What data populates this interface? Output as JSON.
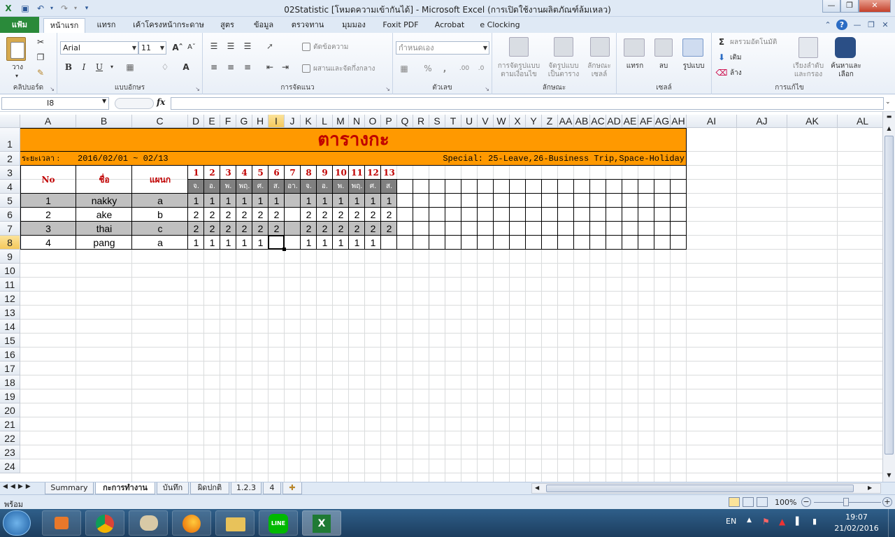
{
  "window": {
    "title": "02Statistic  [โหมดความเข้ากันได้]  - Microsoft Excel (การเปิดใช้งานผลิตภัณฑ์ล้มเหลว)"
  },
  "ribbon_tabs": [
    "แฟ้ม",
    "หน้าแรก",
    "แทรก",
    "เค้าโครงหน้ากระดาษ",
    "สูตร",
    "ข้อมูล",
    "ตรวจทาน",
    "มุมมอง",
    "Foxit PDF",
    "Acrobat",
    "e Clocking"
  ],
  "ribbon": {
    "clipboard": {
      "paste": "วาง",
      "label": "คลิปบอร์ด"
    },
    "font": {
      "name": "Arial",
      "size": "11",
      "bold": "B",
      "italic": "I",
      "underline": "U",
      "label": "แบบอักษร"
    },
    "alignment": {
      "wrap": "ตัดข้อความ",
      "merge": "ผสานและจัดกึ่งกลาง",
      "label": "การจัดแนว"
    },
    "number": {
      "format": "กำหนดเอง",
      "percent": "%",
      "comma": ",",
      "label": "ตัวเลข"
    },
    "styles": {
      "conditional": "การจัดรูปแบบตามเงื่อนไข",
      "table": "จัดรูปแบบเป็นตาราง",
      "cell": "ลักษณะเซลล์",
      "label": "ลักษณะ"
    },
    "cells": {
      "insert": "แทรก",
      "delete": "ลบ",
      "format": "รูปแบบ",
      "label": "เซลล์"
    },
    "editing": {
      "autosum": "ผลรวมอัตโนมัติ",
      "fill": "เติม",
      "clear": "ล้าง",
      "sort": "เรียงลำดับและกรอง",
      "find": "ค้นหาและเลือก",
      "label": "การแก้ไข"
    }
  },
  "formula_bar": {
    "name_box": "I8",
    "fx": "fx",
    "formula": ""
  },
  "columns": [
    "A",
    "B",
    "C",
    "D",
    "E",
    "F",
    "G",
    "H",
    "I",
    "J",
    "K",
    "L",
    "M",
    "N",
    "O",
    "P",
    "Q",
    "R",
    "S",
    "T",
    "U",
    "V",
    "W",
    "X",
    "Y",
    "Z",
    "AA",
    "AB",
    "AC",
    "AD",
    "AE",
    "AF",
    "AG",
    "AH",
    "AI",
    "AJ",
    "AK",
    "AL"
  ],
  "rows": [
    "1",
    "2",
    "3",
    "4",
    "5",
    "6",
    "7",
    "8",
    "9",
    "10",
    "11",
    "12",
    "13",
    "14",
    "15",
    "16",
    "17",
    "18",
    "19",
    "20",
    "21",
    "22",
    "23",
    "24"
  ],
  "sheet": {
    "title": "ตารางกะ",
    "period_label": "ระยะเวลา :",
    "period_value": "2016/02/01 ~ 02/13",
    "special": "Special: 25-Leave,26-Business Trip,Space-Holiday",
    "headers": {
      "no": "No",
      "name": "ชื่อ",
      "dept": "แผนก"
    },
    "days": [
      "1",
      "2",
      "3",
      "4",
      "5",
      "6",
      "7",
      "8",
      "9",
      "10",
      "11",
      "12",
      "13"
    ],
    "weekdays": [
      "จ.",
      "อ.",
      "พ.",
      "พฤ.",
      "ศ.",
      "ส.",
      "อา.",
      "จ.",
      "อ.",
      "พ.",
      "พฤ.",
      "ศ.",
      "ส."
    ],
    "employees": [
      {
        "no": "1",
        "name": "nakky",
        "dept": "a",
        "shifts": [
          "1",
          "1",
          "1",
          "1",
          "1",
          "1",
          "",
          "1",
          "1",
          "1",
          "1",
          "1",
          "1"
        ]
      },
      {
        "no": "2",
        "name": "ake",
        "dept": "b",
        "shifts": [
          "2",
          "2",
          "2",
          "2",
          "2",
          "2",
          "",
          "2",
          "2",
          "2",
          "2",
          "2",
          "2"
        ]
      },
      {
        "no": "3",
        "name": "thai",
        "dept": "c",
        "shifts": [
          "2",
          "2",
          "2",
          "2",
          "2",
          "2",
          "",
          "2",
          "2",
          "2",
          "2",
          "2",
          "2"
        ]
      },
      {
        "no": "4",
        "name": "pang",
        "dept": "a",
        "shifts": [
          "1",
          "1",
          "1",
          "1",
          "1",
          "",
          "",
          "1",
          "1",
          "1",
          "1",
          "1",
          ""
        ]
      }
    ]
  },
  "sheet_tabs": [
    "Summary",
    "กะการทำงาน",
    "บันทึก",
    "ผิดปกติ",
    "1.2.3",
    "4"
  ],
  "status": {
    "ready": "พร้อม",
    "zoom": "100%"
  },
  "taskbar": {
    "lang": "EN",
    "time": "19:07",
    "date": "21/02/2016"
  },
  "colors": {
    "title_fill": "#ff9900",
    "title_text": "#c00000",
    "header_text": "#c00000",
    "weekday_fill": "#808080",
    "band_fill": "#c0c0c0",
    "accent": "#2a8a3a"
  }
}
